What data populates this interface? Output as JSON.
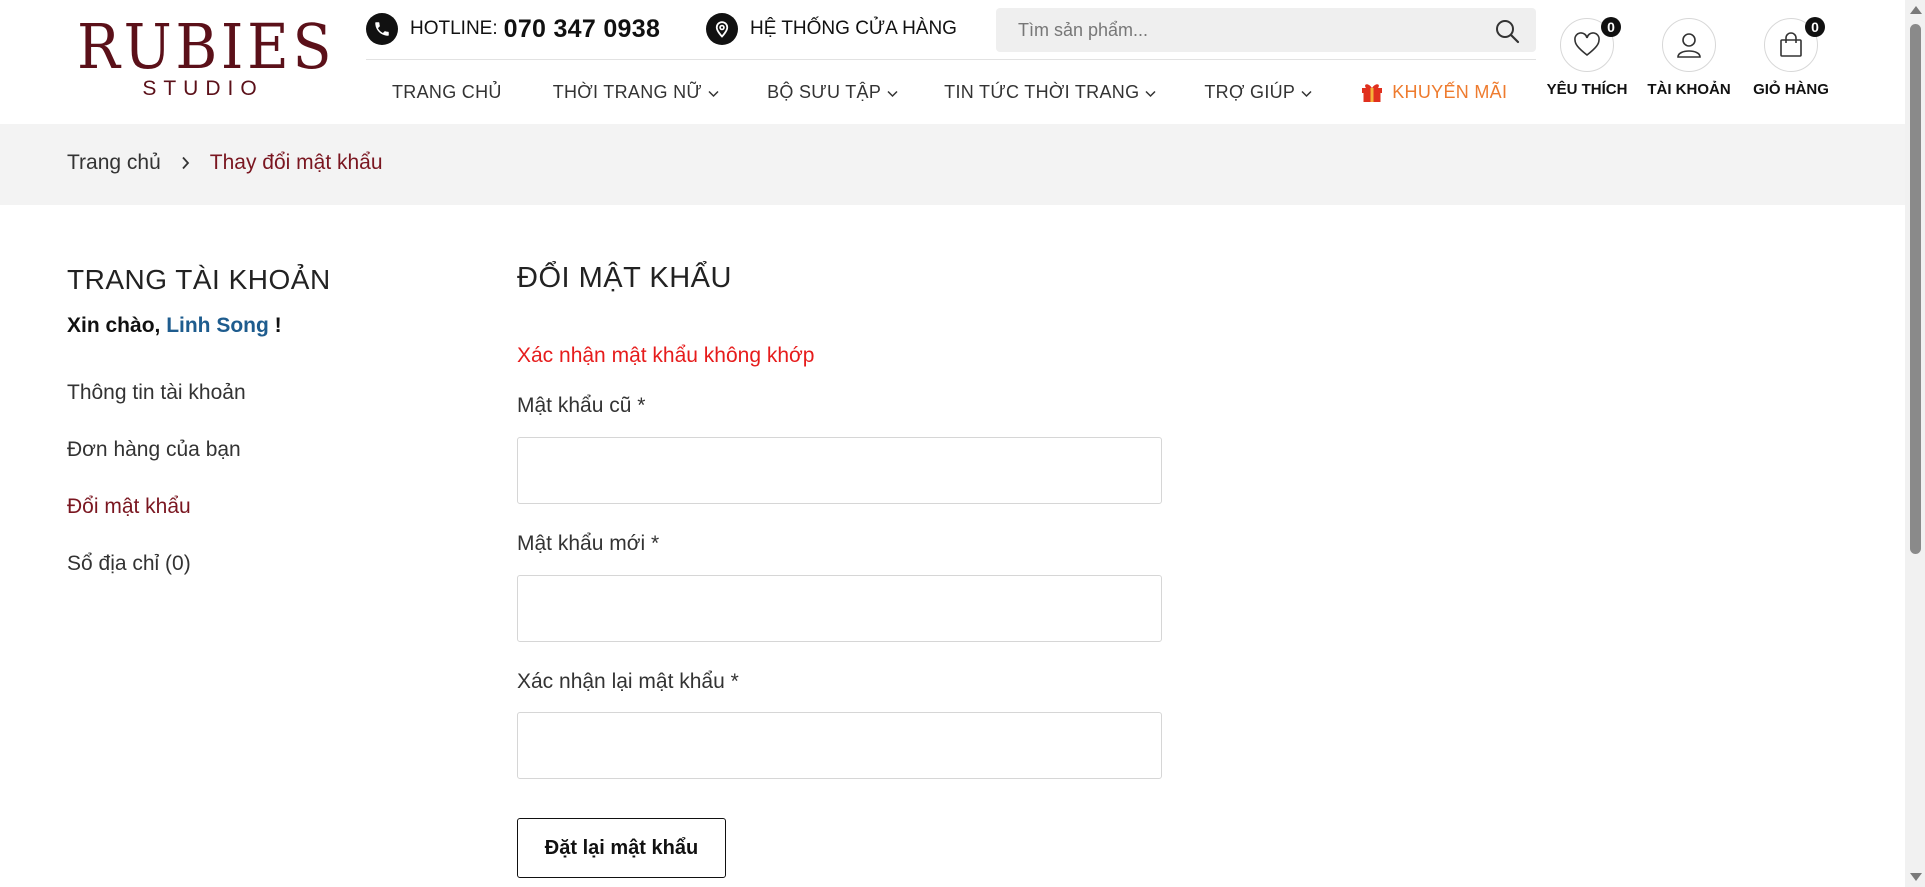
{
  "brand": {
    "logo_main": "RUBIES",
    "logo_sub": "STUDIO",
    "color": "#5b1019"
  },
  "topbar": {
    "hotline_label": "HOTLINE:",
    "hotline_number": "070 347 0938",
    "stores_label": "HỆ THỐNG CỬA HÀNG",
    "search_placeholder": "Tìm sản phẩm..."
  },
  "nav": {
    "items": [
      {
        "label": "TRANG CHỦ",
        "has_dropdown": false
      },
      {
        "label": "THỜI TRANG NỮ",
        "has_dropdown": true
      },
      {
        "label": "BỘ SƯU TẬP",
        "has_dropdown": true
      },
      {
        "label": "TIN TỨC THỜI TRANG",
        "has_dropdown": true
      },
      {
        "label": "TRỢ GIÚP",
        "has_dropdown": true
      }
    ],
    "promo_label": "KHUYẾN MÃI",
    "promo_color": "#ee7b2e"
  },
  "header_icons": {
    "wishlist": {
      "label": "YÊU THÍCH",
      "count": "0"
    },
    "account": {
      "label": "TÀI KHOẢN"
    },
    "cart": {
      "label": "GIỎ HÀNG",
      "count": "0"
    }
  },
  "breadcrumb": {
    "home": "Trang chủ",
    "current": "Thay đổi mật khẩu"
  },
  "sidebar": {
    "title": "TRANG TÀI KHOẢN",
    "greeting_prefix": "Xin chào, ",
    "user_name": "Linh Song",
    "greeting_suffix": " !",
    "links": [
      {
        "label": "Thông tin tài khoản",
        "active": false
      },
      {
        "label": "Đơn hàng của bạn",
        "active": false
      },
      {
        "label": "Đổi mật khẩu",
        "active": true
      },
      {
        "label": "Sổ địa chỉ (0)",
        "active": false
      }
    ]
  },
  "form": {
    "title": "ĐỔI MẬT KHẨU",
    "error": "Xác nhận mật khẩu không khớp",
    "old_password_label": "Mật khẩu cũ",
    "new_password_label": "Mật khẩu mới",
    "confirm_password_label": "Xác nhận lại mật khẩu",
    "required_mark": "*",
    "submit_label": "Đặt lại mật khẩu"
  },
  "colors": {
    "accent_dark_red": "#7a1620",
    "error_red": "#e61c1c",
    "link_blue": "#1e5c8e"
  }
}
